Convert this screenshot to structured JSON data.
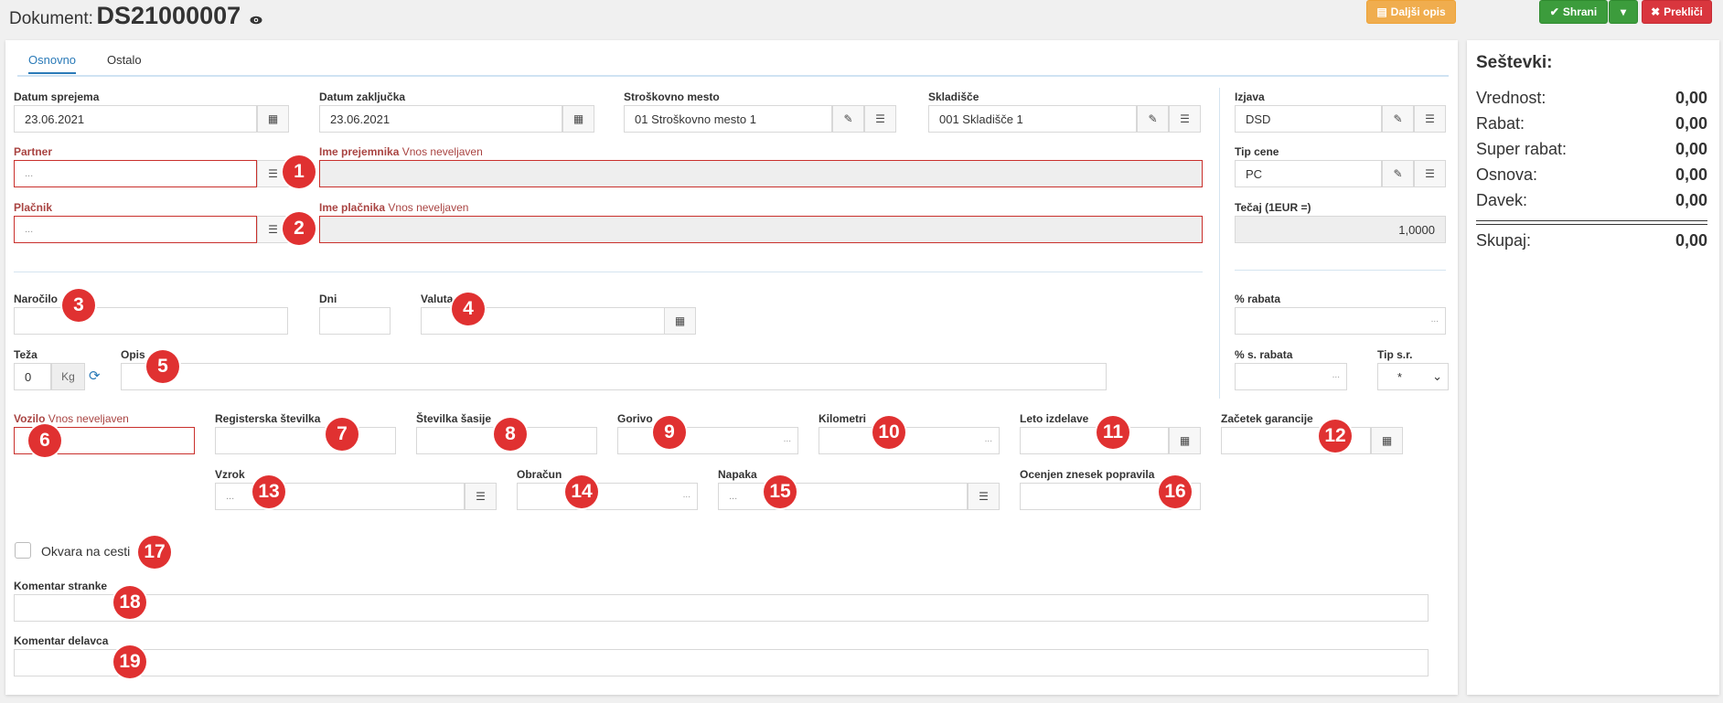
{
  "header": {
    "document_label": "Dokument:",
    "document_number": "DS21000007",
    "eye_icon": "eye-icon",
    "more_desc_label": "Daljši opis",
    "save_label": "Shrani",
    "cancel_label": "Prekliči",
    "colors": {
      "warning": "#f0ad4e",
      "success": "#3c9c3c",
      "danger": "#d9363e"
    }
  },
  "tabs": [
    {
      "label": "Osnovno",
      "active": true
    },
    {
      "label": "Ostalo",
      "active": false
    }
  ],
  "form": {
    "datum_sprejema": {
      "label": "Datum sprejema",
      "value": "23.06.2021"
    },
    "datum_zakljucka": {
      "label": "Datum zaključka",
      "value": "23.06.2021"
    },
    "strosk_mesto": {
      "label": "Stroškovno mesto",
      "value": "01 Stroškovno mesto 1"
    },
    "skladisce": {
      "label": "Skladišče",
      "value": "001 Skladišče 1"
    },
    "izjava": {
      "label": "Izjava",
      "value": "DSD"
    },
    "partner": {
      "label": "Partner",
      "placeholder": "..."
    },
    "ime_prejemnika": {
      "label": "Ime prejemnika",
      "note": "Vnos neveljaven"
    },
    "tip_cene": {
      "label": "Tip cene",
      "value": "PC"
    },
    "placnik": {
      "label": "Plačnik",
      "placeholder": "..."
    },
    "ime_placnika": {
      "label": "Ime plačnika",
      "note": "Vnos neveljaven"
    },
    "tecaj": {
      "label": "Tečaj (1EUR =)",
      "value": "1,0000"
    },
    "narocilo": {
      "label": "Naročilo"
    },
    "dni": {
      "label": "Dni"
    },
    "valuta": {
      "label": "Valuta"
    },
    "rabat": {
      "label": "% rabata",
      "placeholder": "..."
    },
    "teza": {
      "label": "Teža",
      "value": "0",
      "unit": "Kg"
    },
    "opis": {
      "label": "Opis"
    },
    "s_rabat": {
      "label": "% s. rabata",
      "placeholder": "..."
    },
    "tip_sr": {
      "label": "Tip s.r.",
      "value": "*"
    },
    "vozilo": {
      "label": "Vozilo",
      "note": "Vnos neveljaven"
    },
    "reg_stevilka": {
      "label": "Registerska številka"
    },
    "st_sasije": {
      "label": "Številka šasije"
    },
    "gorivo": {
      "label": "Gorivo",
      "placeholder": "..."
    },
    "kilometri": {
      "label": "Kilometri",
      "placeholder": "..."
    },
    "leto_izdelave": {
      "label": "Leto izdelave"
    },
    "zacetek_garancije": {
      "label": "Začetek garancije"
    },
    "vzrok": {
      "label": "Vzrok",
      "placeholder": "..."
    },
    "obracun": {
      "label": "Obračun",
      "placeholder": "..."
    },
    "napaka": {
      "label": "Napaka",
      "placeholder": "..."
    },
    "ocenjen_znesek": {
      "label": "Ocenjen znesek popravila"
    },
    "okvara": {
      "label": "Okvara na cesti",
      "checked": false
    },
    "komentar_stranke": {
      "label": "Komentar stranke"
    },
    "komentar_delavca": {
      "label": "Komentar delavca"
    }
  },
  "badges": [
    "1",
    "2",
    "3",
    "4",
    "5",
    "6",
    "7",
    "8",
    "9",
    "10",
    "11",
    "12",
    "13",
    "14",
    "15",
    "16",
    "17",
    "18",
    "19"
  ],
  "summary": {
    "title": "Seštevki:",
    "rows": [
      {
        "label": "Vrednost:",
        "value": "0,00"
      },
      {
        "label": "Rabat:",
        "value": "0,00"
      },
      {
        "label": "Super rabat:",
        "value": "0,00"
      },
      {
        "label": "Osnova:",
        "value": "0,00"
      },
      {
        "label": "Davek:",
        "value": "0,00"
      }
    ],
    "total": {
      "label": "Skupaj:",
      "value": "0,00"
    }
  }
}
